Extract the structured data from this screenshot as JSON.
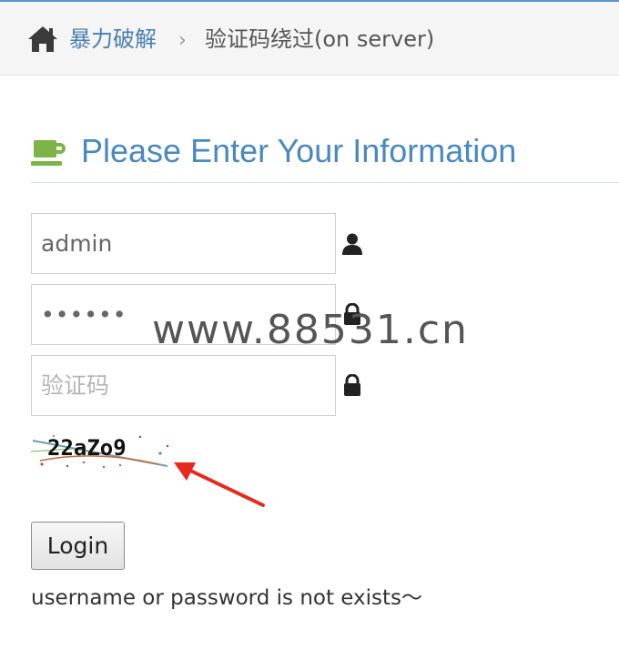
{
  "breadcrumb": {
    "home_icon": "home-icon",
    "parent": "暴力破解",
    "separator": "›",
    "current": "验证码绕过(on server)"
  },
  "header": {
    "icon": "coffee-cup-icon",
    "title": "Please Enter Your Information",
    "title_color": "#4a88c2"
  },
  "form": {
    "username_value": "admin",
    "password_value": "••••••",
    "captcha_placeholder": "验证码",
    "username_icon": "user-icon",
    "password_icon": "lock-icon",
    "captcha_icon": "lock-icon",
    "captcha_image_text": "22aZo9",
    "login_label": "Login"
  },
  "watermark": "www.88531.cn",
  "annotation": {
    "arrow_color": "#e8281c"
  },
  "message": "username or password is not exists～"
}
